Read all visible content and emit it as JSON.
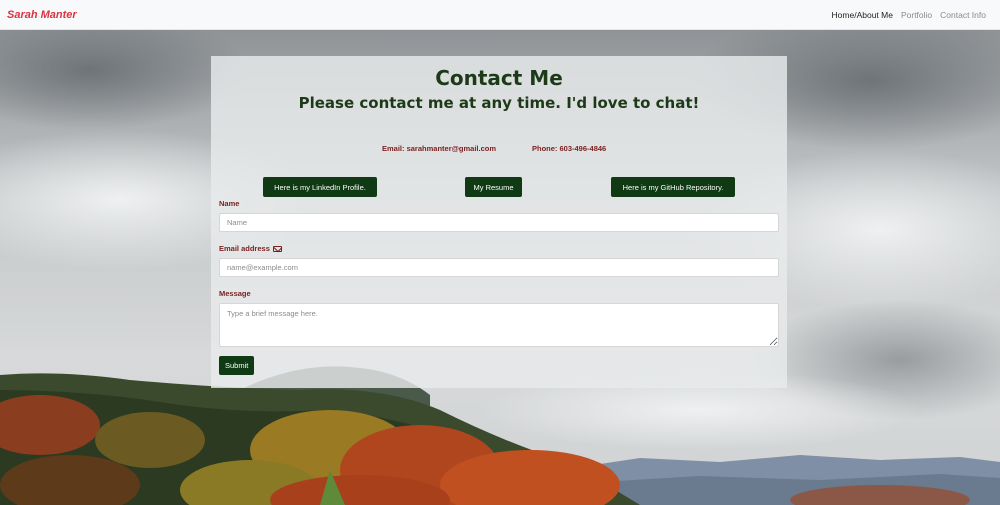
{
  "navbar": {
    "brand": "Sarah Manter",
    "links": [
      {
        "label": "Home/About Me",
        "active": true
      },
      {
        "label": "Portfolio",
        "active": false
      },
      {
        "label": "Contact Info",
        "active": false
      }
    ]
  },
  "contact": {
    "title": "Contact Me",
    "subtitle": "Please contact me at any time. I'd love to chat!",
    "email_line": "Email: sarahmanter@gmail.com",
    "phone_line": "Phone: 603-496-4846",
    "buttons": {
      "linkedin": "Here is my LinkedIn Profile.",
      "resume": "My Resume",
      "github": "Here is my GitHub Repository."
    }
  },
  "form": {
    "name_label": "Name",
    "name_placeholder": "Name",
    "email_label": "Email address",
    "email_icon": "envelope-icon",
    "email_placeholder": "name@example.com",
    "message_label": "Message",
    "message_placeholder": "Type a brief message here.",
    "submit_label": "Submit"
  },
  "colors": {
    "brand": "#d9333f",
    "heading_green": "#1d3a18",
    "button_green": "#0f3a14",
    "label_red": "#7a1f1f"
  }
}
